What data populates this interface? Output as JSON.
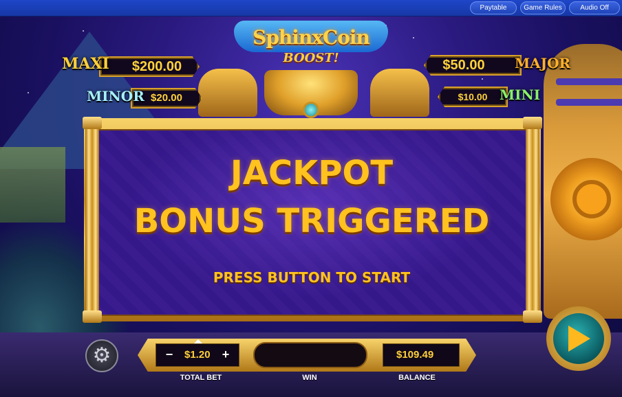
{
  "topbar": {
    "paytable": "Paytable",
    "game_rules": "Game Rules",
    "audio": "Audio Off"
  },
  "logo": {
    "line1": "SphinxCoin",
    "line2": "BOOST!"
  },
  "jackpots": {
    "maxi": {
      "name": "MAXI",
      "value": "$200.00"
    },
    "minor": {
      "name": "MINOR",
      "value": "$20.00"
    },
    "major": {
      "name": "MAJOR",
      "value": "$50.00"
    },
    "mini": {
      "name": "MINI",
      "value": "$10.00"
    }
  },
  "panel": {
    "line1": "JACKPOT",
    "line2": "BONUS TRIGGERED",
    "prompt": "PRESS BUTTON TO START"
  },
  "controls": {
    "minus": "−",
    "plus": "+",
    "total_bet_value": "$1.20",
    "total_bet_label": "TOTAL BET",
    "win_label": "WIN",
    "balance_value": "$109.49",
    "balance_label": "BALANCE"
  },
  "icons": {
    "settings": "gear-icon",
    "spin": "play-icon"
  },
  "colors": {
    "gold_text": "#ffc21e",
    "panel_purple": "#3a1c8e",
    "topbar_blue": "#1e46c8"
  }
}
